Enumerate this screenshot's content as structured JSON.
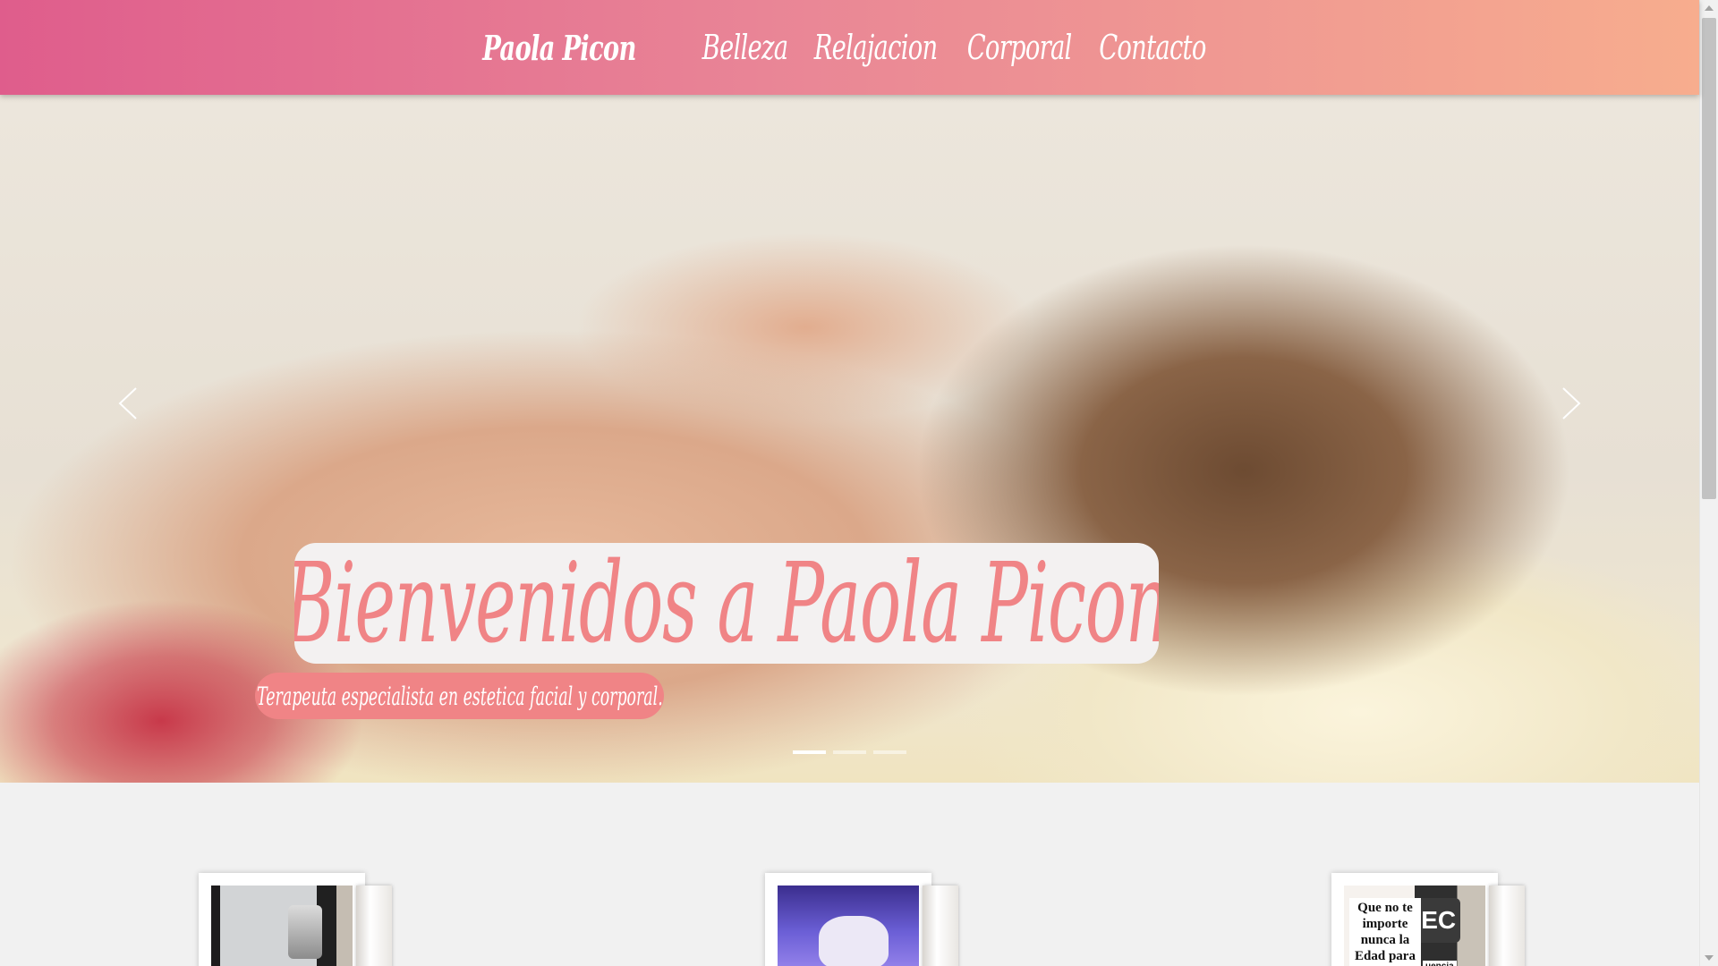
{
  "header": {
    "brand": "Paola Picon",
    "nav": [
      {
        "label": "Belleza"
      },
      {
        "label": "Relajacion"
      },
      {
        "label": "Corporal"
      },
      {
        "label": "Contacto"
      }
    ],
    "gradient_colors": [
      "#df5d8c",
      "#f7ad8e"
    ]
  },
  "hero": {
    "title": "Bienvenidos a Paola Picon",
    "subtitle": "Terapeuta especialista en estetica facial y corporal.",
    "slide_count": 3,
    "active_slide": 1,
    "accent_color": "#f08486"
  },
  "cards": [
    {
      "caption": ""
    },
    {
      "caption": ""
    },
    {
      "caption": "Que no te importe nunca la Edad para",
      "overlay_text": "REC",
      "tag": "uencia"
    }
  ]
}
